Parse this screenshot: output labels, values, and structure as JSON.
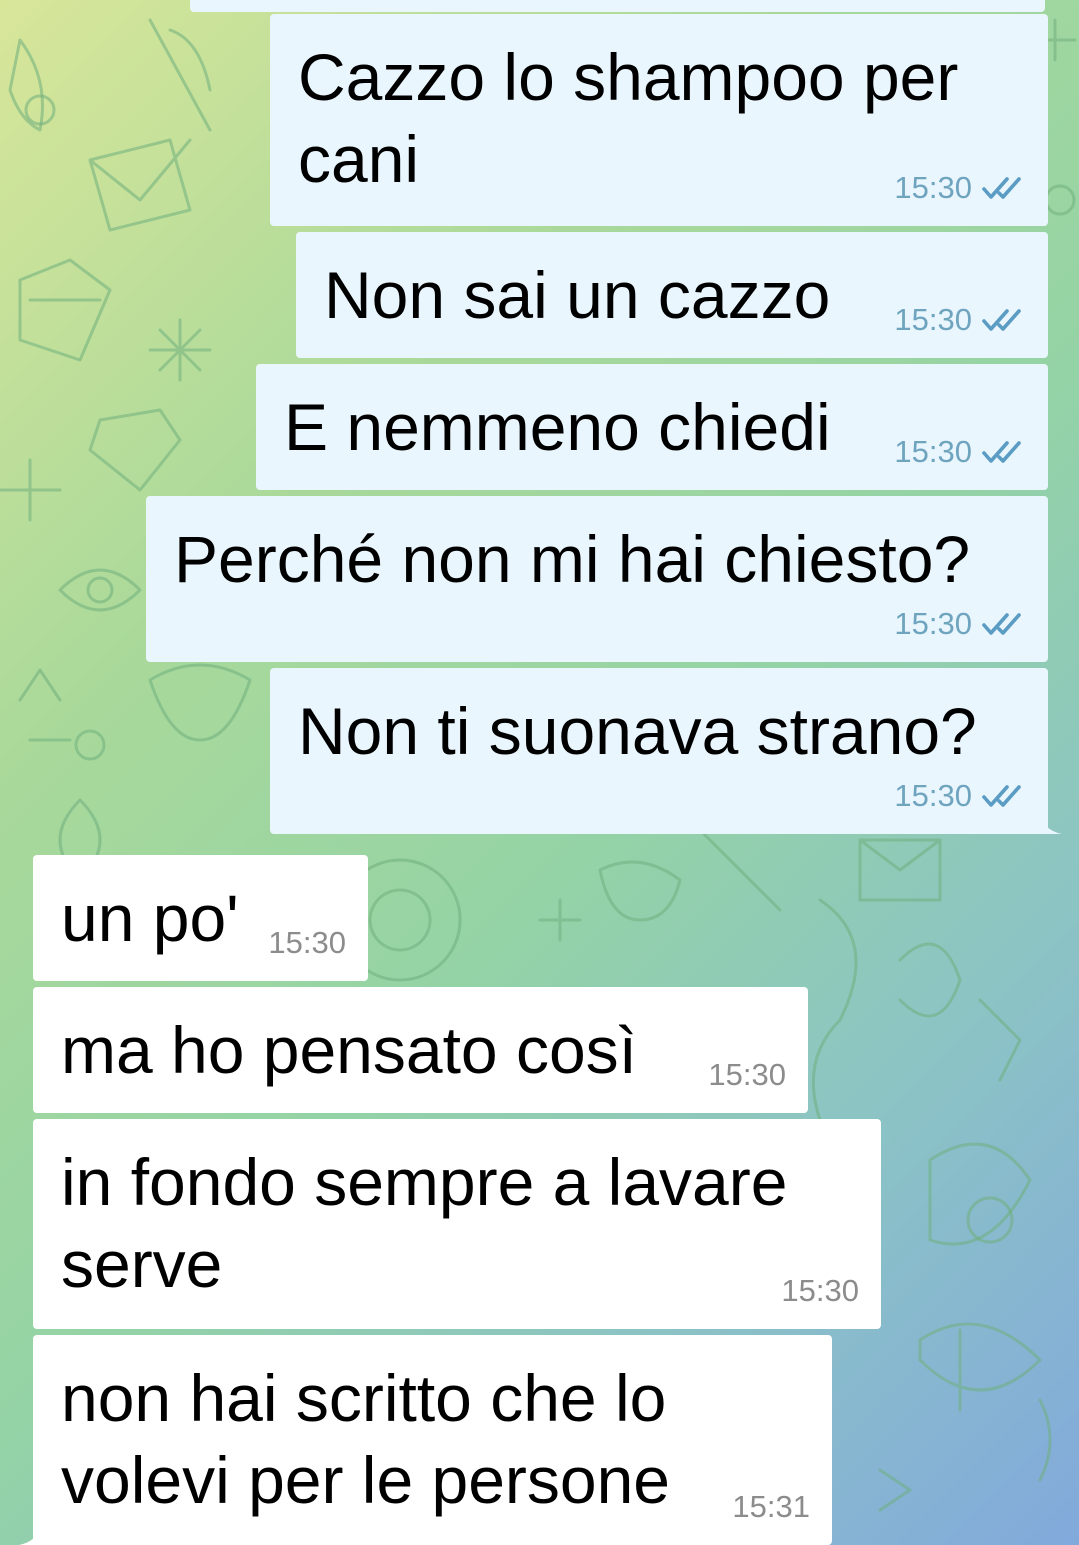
{
  "theme": {
    "outgoing_bg": "#eaf6fd",
    "incoming_bg": "#ffffff",
    "tick_color": "#5a9cc4"
  },
  "messages": [
    {
      "dir": "out",
      "text": "Cazzo lo shampoo per\ncani",
      "time": "15:30",
      "status": "read-double-check-icon"
    },
    {
      "dir": "out",
      "text": "Non sai un cazzo",
      "time": "15:30",
      "status": "read-double-check-icon"
    },
    {
      "dir": "out",
      "text": "E nemmeno chiedi",
      "time": "15:30",
      "status": "read-double-check-icon"
    },
    {
      "dir": "out",
      "text": "Perché non mi hai chiesto?",
      "time": "15:30",
      "status": "read-double-check-icon"
    },
    {
      "dir": "out",
      "text": "Non ti suonava strano?",
      "time": "15:30",
      "status": "read-double-check-icon"
    },
    {
      "dir": "in",
      "text": "un po'",
      "time": "15:30"
    },
    {
      "dir": "in",
      "text": "ma ho pensato così",
      "time": "15:30"
    },
    {
      "dir": "in",
      "text": "in fondo sempre a lavare\nserve",
      "time": "15:30"
    },
    {
      "dir": "in",
      "text": "non hai scritto che lo\nvolevi per le persone",
      "time": "15:31"
    }
  ]
}
